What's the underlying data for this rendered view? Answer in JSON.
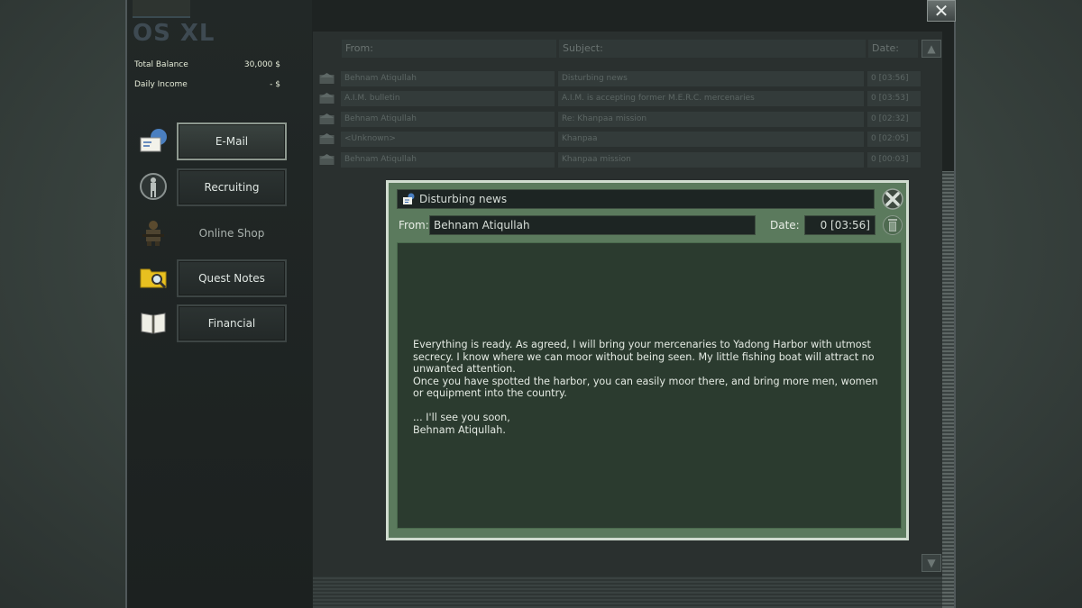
{
  "os": {
    "logo": "OS XL"
  },
  "account": {
    "total_balance_label": "Total Balance",
    "total_balance_value": "30,000 $",
    "daily_income_label": "Daily Income",
    "daily_income_value": "- $"
  },
  "nav": [
    {
      "label": "E-Mail",
      "icon": "email-icon",
      "active": true
    },
    {
      "label": "Recruiting",
      "icon": "soldier-icon"
    },
    {
      "label": "Online Shop",
      "icon": "shop-merc-icon"
    },
    {
      "label": "Quest Notes",
      "icon": "folder-search-icon"
    },
    {
      "label": "Financial",
      "icon": "book-icon"
    }
  ],
  "mail_list": {
    "headers": {
      "from": "From:",
      "subject": "Subject:",
      "date": "Date:"
    },
    "rows": [
      {
        "from": "Behnam Atiqullah",
        "subject": "Disturbing news",
        "date": "0 [03:56]"
      },
      {
        "from": "A.I.M. bulletin",
        "subject": "A.I.M. is accepting former M.E.R.C. mercenaries",
        "date": "0 [03:53]"
      },
      {
        "from": "Behnam Atiqullah",
        "subject": "Re: Khanpaa mission",
        "date": "0 [02:32]"
      },
      {
        "from": "<Unknown>",
        "subject": "Khanpaa",
        "date": "0 [02:05]"
      },
      {
        "from": "Behnam Atiqullah",
        "subject": "Khanpaa mission",
        "date": "0 [00:03]"
      }
    ]
  },
  "message": {
    "title": "Disturbing news",
    "from_label": "From:",
    "from_value": "Behnam Atiqullah",
    "date_label": "Date:",
    "date_value": "0 [03:56]",
    "body": "Everything is ready. As agreed, I will bring your mercenaries to Yadong Harbor with utmost secrecy. I know where we can moor without being seen. My little fishing boat will attract no unwanted attention.\nOnce you have spotted the harbor, you can easily moor there, and bring more men, women or equipment into the country.\n\n... I'll see you soon,\nBehnam Atiqullah."
  },
  "colors": {
    "dialog_green": "#5b7a5d",
    "dialog_border": "#d0dccf",
    "frame_dark": "#1e2322"
  }
}
